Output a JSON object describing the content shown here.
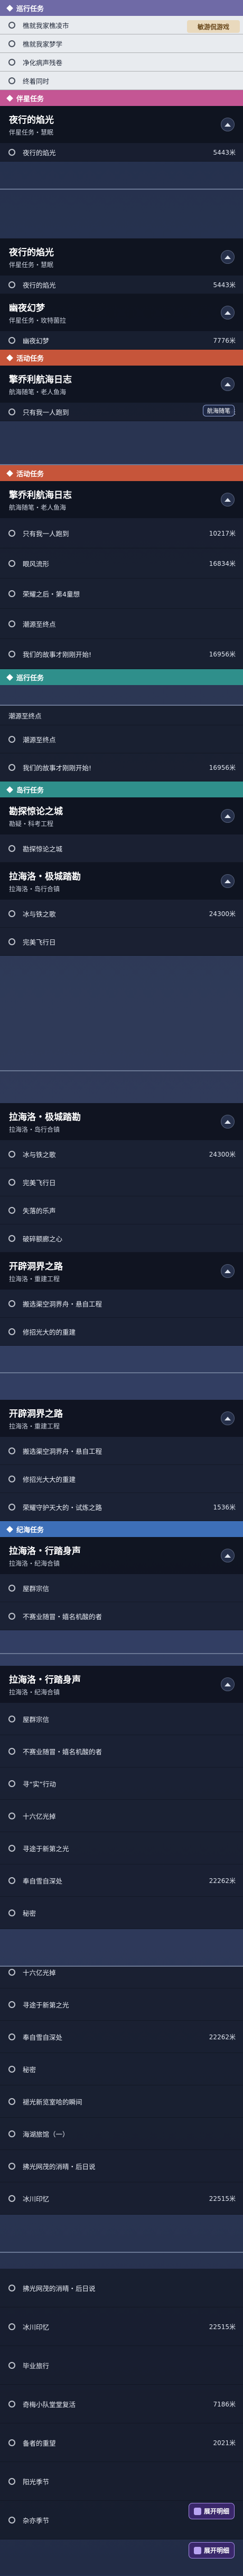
{
  "watermark": "敏游侃游戏",
  "distance_unit": "米",
  "frame_a": {
    "cat1": {
      "label": "巡行任务",
      "color": "#6f6aa6"
    },
    "light_rows": [
      "樵就我家樵凌市",
      "樵就我家梦学",
      "净化病声残卷",
      "终着同时"
    ],
    "cat2": {
      "label": "伴星任务",
      "color": "#c45694"
    },
    "head": {
      "title": "夜行的焰光",
      "subtitle": "伴星任务・慧眠"
    },
    "rows": [
      {
        "name": "夜行的焰光",
        "dist": "5443"
      }
    ]
  },
  "frame_b": {
    "head": {
      "title": "夜行的焰光",
      "subtitle": "伴星任务・慧眠"
    },
    "rows1": [
      {
        "name": "夜行的焰光",
        "dist": "5443"
      }
    ],
    "head2": {
      "title": "幽夜幻梦",
      "subtitle": "伴星任务・玫特菌拉"
    },
    "rows2": [
      {
        "name": "幽夜幻梦",
        "dist": "7776"
      }
    ],
    "cat": {
      "label": "活动任务",
      "color": "#c6553a"
    },
    "head3": {
      "title": "擎乔利航海日志",
      "subtitle": "航海随笔・老人鱼海"
    },
    "stamp": "航海随笔",
    "rows3": [
      {
        "name": "只有我一人跑到",
        "dist": "10217"
      }
    ]
  },
  "frame_c": {
    "cat": {
      "label": "活动任务",
      "color": "#c6553a"
    },
    "head": {
      "title": "擎乔利航海日志",
      "subtitle": "航海随笔・老人鱼海"
    },
    "rows": [
      {
        "name": "只有我一人跑到",
        "dist": "10217"
      },
      {
        "name": "眼风流形",
        "dist": "16834"
      },
      {
        "name": "荣耀之后・第4童想",
        "dist": ""
      },
      {
        "name": "潮源至终点",
        "dist": ""
      },
      {
        "name": "我们的故事才刚刚开始!",
        "dist": "16956"
      }
    ],
    "cat2": {
      "label": "巡行任务",
      "color": "#2f8f8b"
    }
  },
  "frame_d": {
    "partial_header": "潮源至终点",
    "rows": [
      {
        "name": "潮源至终点",
        "dist": ""
      },
      {
        "name": "我们的故事才刚刚开始!",
        "dist": "16956"
      }
    ],
    "cat": {
      "label": "岛行任务",
      "color": "#2f8f8b"
    },
    "head": {
      "title": "勘探惊论之城",
      "subtitle": "勘疑・科考工程"
    },
    "rows2": [
      {
        "name": "勘探惊论之城",
        "dist": ""
      }
    ],
    "head2": {
      "title": "拉海洛・极城踏勘",
      "subtitle": "拉海洛・岛行合镇"
    },
    "rows3": [
      {
        "name": "冰与铁之歌",
        "dist": "24300"
      },
      {
        "name": "完美飞行日",
        "dist": ""
      }
    ]
  },
  "frame_e": {
    "head": {
      "title": "拉海洛・极城踏勘",
      "subtitle": "拉海洛・岛行合镇"
    },
    "rows": [
      {
        "name": "冰与铁之歌",
        "dist": "24300"
      },
      {
        "name": "完美飞行日",
        "dist": ""
      },
      {
        "name": "失落的乐声",
        "dist": ""
      },
      {
        "name": "破碎额廊之心",
        "dist": ""
      }
    ],
    "head2": {
      "title": "开辟洞界之路",
      "subtitle": "拉海洛・重建工程"
    },
    "rows2": [
      {
        "name": "搬选渠空洞界舟・悬自工程",
        "dist": ""
      },
      {
        "name": "修招光大的的重建",
        "dist": ""
      }
    ]
  },
  "frame_f": {
    "head": {
      "title": "开辟洞界之路",
      "subtitle": "拉海洛・重建工程"
    },
    "rows": [
      {
        "name": "搬选渠空洞界舟・悬自工程",
        "dist": ""
      },
      {
        "name": "修招光大大的重建",
        "dist": ""
      },
      {
        "name": "荣耀守护天大的・试炼之路",
        "dist": "1536"
      }
    ],
    "cat": {
      "label": "纪海任务",
      "color": "#3d6fb8"
    },
    "head2": {
      "title": "拉海洛・行踏身声",
      "subtitle": "拉海洛・纪海合镇"
    },
    "rows2": [
      {
        "name": "屋群宗信",
        "dist": ""
      },
      {
        "name": "不赛业随冒・嬉名机酸的者",
        "dist": ""
      }
    ]
  },
  "frame_g": {
    "head": {
      "title": "拉海洛・行踏身声",
      "subtitle": "拉海洛・纪海合镇"
    },
    "rows": [
      {
        "name": "屋群宗信",
        "dist": ""
      },
      {
        "name": "不赛业随冒・嬉名机酸的者",
        "dist": ""
      },
      {
        "name": "寻“实”行动",
        "dist": ""
      },
      {
        "name": "十六亿光掉",
        "dist": ""
      },
      {
        "name": "寻途于新第之光",
        "dist": ""
      },
      {
        "name": "奉自雪自深处",
        "dist": "22262"
      },
      {
        "name": "秘密",
        "dist": ""
      }
    ]
  },
  "frame_h": {
    "rows": [
      {
        "name": "十六亿光掉",
        "dist": ""
      },
      {
        "name": "寻途于新第之光",
        "dist": ""
      },
      {
        "name": "奉自雪自深处",
        "dist": "22262"
      },
      {
        "name": "秘密",
        "dist": ""
      },
      {
        "name": "褪光新览室哈的瞬间",
        "dist": ""
      },
      {
        "name": "海湖旅馆（一）",
        "dist": ""
      },
      {
        "name": "拂光网茂的消晴・后日说",
        "dist": ""
      },
      {
        "name": "冰川印忆",
        "dist": "22515"
      }
    ]
  },
  "frame_i": {
    "rows": [
      {
        "name": "拂光网茂的消晴・后日说",
        "dist": ""
      },
      {
        "name": "冰川印忆",
        "dist": "22515"
      },
      {
        "name": "毕业旅行",
        "dist": ""
      },
      {
        "name": "奇梅小队堂堂复活",
        "dist": "7186"
      },
      {
        "name": "备者的重望",
        "dist": "2021"
      },
      {
        "name": "阳光季节",
        "dist": ""
      },
      {
        "name": "杂亦季节",
        "dist": ""
      }
    ],
    "badges": [
      "展开明细",
      "展开明细"
    ]
  }
}
